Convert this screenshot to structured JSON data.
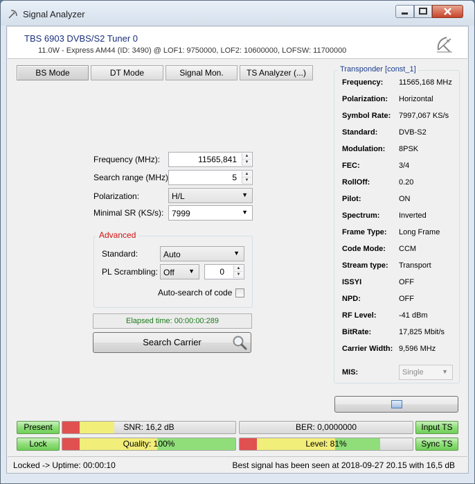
{
  "window": {
    "title": "Signal Analyzer"
  },
  "header": {
    "device_name": "TBS 6903 DVBS/S2 Tuner 0",
    "device_info": "11.0W - Express AM44 (ID: 3490) @ LOF1: 9750000, LOF2: 10600000, LOFSW: 11700000"
  },
  "tabs": [
    {
      "label": "BS Mode",
      "active": true
    },
    {
      "label": "DT Mode",
      "active": false
    },
    {
      "label": "Signal Mon.",
      "active": false
    },
    {
      "label": "TS Analyzer (...)",
      "active": false
    }
  ],
  "form": {
    "frequency_label": "Frequency (MHz):",
    "frequency_value": "11565,841",
    "search_range_label": "Search range (MHz):",
    "search_range_value": "5",
    "polarization_label": "Polarization:",
    "polarization_value": "H/L",
    "min_sr_label": "Minimal SR (KS/s):",
    "min_sr_value": "7999"
  },
  "advanced": {
    "title": "Advanced",
    "standard_label": "Standard:",
    "standard_value": "Auto",
    "pl_scrambling_label": "PL Scrambling:",
    "pl_scrambling_value": "Off",
    "pl_code_value": "0",
    "auto_search_label": "Auto-search of code",
    "auto_search_checked": false
  },
  "elapsed": "Elapsed time: 00:00:00:289",
  "search_button": "Search Carrier",
  "transponder": {
    "title": "Transponder [const_1]",
    "rows": [
      {
        "key": "Frequency:",
        "value": "11565,168 MHz"
      },
      {
        "key": "Polarization:",
        "value": "Horizontal"
      },
      {
        "key": "Symbol Rate:",
        "value": "7997,067 KS/s"
      },
      {
        "key": "Standard:",
        "value": "DVB-S2"
      },
      {
        "key": "Modulation:",
        "value": "8PSK"
      },
      {
        "key": "FEC:",
        "value": "3/4"
      },
      {
        "key": "RollOff:",
        "value": "0.20"
      },
      {
        "key": "Pilot:",
        "value": "ON"
      },
      {
        "key": "Spectrum:",
        "value": "Inverted"
      },
      {
        "key": "Frame Type:",
        "value": "Long Frame"
      },
      {
        "key": "Code Mode:",
        "value": "CCM"
      },
      {
        "key": "Stream type:",
        "value": "Transport"
      },
      {
        "key": "ISSYI",
        "value": "OFF"
      },
      {
        "key": "NPD:",
        "value": "OFF"
      },
      {
        "key": "RF Level:",
        "value": "-41 dBm"
      },
      {
        "key": "BitRate:",
        "value": "17,825 Mbit/s"
      },
      {
        "key": "Carrier Width:",
        "value": "9,596 MHz"
      }
    ],
    "mis_label": "MIS:",
    "mis_value": "Single"
  },
  "indicators": {
    "present": "Present",
    "lock": "Lock",
    "input_ts": "Input TS",
    "sync_ts": "Sync TS",
    "snr_text": "SNR: 16,2 dB",
    "snr_fraction": 0.3,
    "ber_text": "BER: 0,0000000",
    "ber_fraction": 0,
    "quality_text": "Quality: 100%",
    "quality_fraction": 1.0,
    "level_text": "Level: 81%",
    "level_fraction": 0.81
  },
  "status": {
    "left": "Locked -> Uptime: 00:00:10",
    "right": "Best signal has been seen at 2018-09-27 20.15 with 16,5 dB"
  },
  "colors": {
    "meter_red": "#e05050",
    "meter_yellow": "#f2ee7a",
    "meter_green": "#8fde79"
  }
}
